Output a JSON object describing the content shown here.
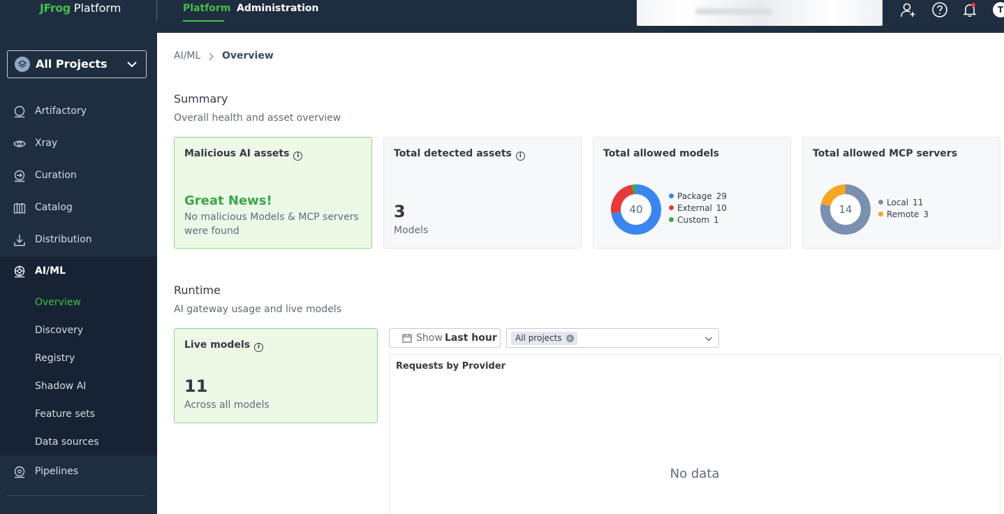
{
  "header": {
    "logo_brand": "JFrog",
    "logo_product": "Platform",
    "tabs": [
      {
        "label": "Platform",
        "active": true
      },
      {
        "label": "Administration",
        "active": false
      }
    ],
    "avatar_initial": "T",
    "icons": [
      "add-user-icon",
      "help-icon",
      "notification-bell-icon"
    ]
  },
  "sidebar": {
    "project_selector": "All Projects",
    "items": [
      {
        "label": "Artifactory",
        "icon": "artifactory-icon"
      },
      {
        "label": "Xray",
        "icon": "eye-icon"
      },
      {
        "label": "Curation",
        "icon": "curation-icon"
      },
      {
        "label": "Catalog",
        "icon": "catalog-icon"
      },
      {
        "label": "Distribution",
        "icon": "distribution-icon"
      },
      {
        "label": "AI/ML",
        "icon": "ai-ml-icon"
      },
      {
        "label": "Pipelines",
        "icon": "pipelines-icon"
      }
    ],
    "aiml_subitems": [
      {
        "label": "Overview",
        "active": true
      },
      {
        "label": "Discovery"
      },
      {
        "label": "Registry"
      },
      {
        "label": "Shadow AI"
      },
      {
        "label": "Feature sets"
      },
      {
        "label": "Data sources"
      }
    ]
  },
  "breadcrumb": {
    "parent": "AI/ML",
    "current": "Overview"
  },
  "summary": {
    "title": "Summary",
    "subtitle": "Overall health and asset overview",
    "malicious": {
      "title": "Malicious AI assets",
      "headline": "Great News!",
      "message": "No malicious Models & MCP servers were found"
    },
    "detected": {
      "title": "Total detected assets",
      "value": "3",
      "unit": "Models"
    },
    "models": {
      "title": "Total allowed models",
      "total": "40",
      "segments": [
        {
          "name": "Package",
          "value": 29,
          "color": "#3a86f0"
        },
        {
          "name": "External",
          "value": 10,
          "color": "#e5393c"
        },
        {
          "name": "Custom",
          "value": 1,
          "color": "#2bb24c"
        }
      ]
    },
    "mcp": {
      "title": "Total allowed MCP servers",
      "total": "14",
      "segments": [
        {
          "name": "Local",
          "value": 11,
          "color": "#7b8fb0"
        },
        {
          "name": "Remote",
          "value": 3,
          "color": "#f5a623"
        }
      ]
    }
  },
  "runtime": {
    "title": "Runtime",
    "subtitle": "AI gateway usage and live models",
    "live": {
      "title": "Live models",
      "value": "11",
      "unit": "Across all models"
    },
    "time_filter": {
      "label": "Show",
      "value": "Last hour"
    },
    "project_filter": {
      "chip": "All projects"
    },
    "chart": {
      "title": "Requests by Provider",
      "empty_text": "No data"
    }
  }
}
